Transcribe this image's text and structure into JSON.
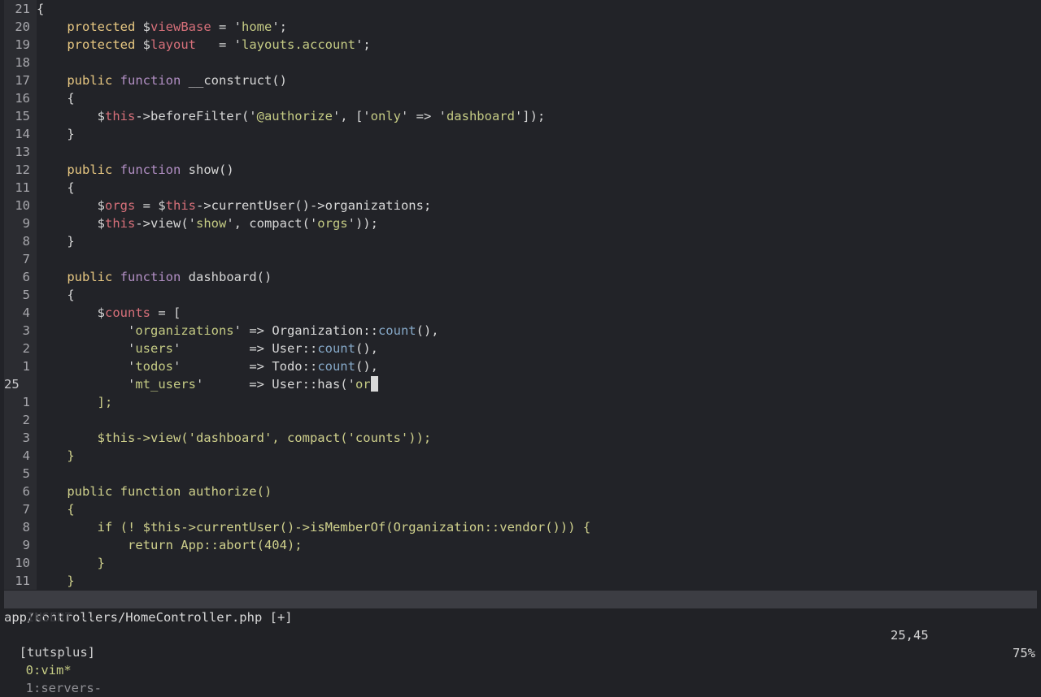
{
  "editor": {
    "lines": [
      {
        "num": "21",
        "tokens": [
          [
            "pl",
            "{"
          ]
        ]
      },
      {
        "num": "20",
        "tokens": [
          [
            "pl",
            "    "
          ],
          [
            "kw",
            "protected"
          ],
          [
            "pl",
            " $"
          ],
          [
            "var",
            "viewBase"
          ],
          [
            "pl",
            " = '"
          ],
          [
            "str",
            "home"
          ],
          [
            "pl",
            "';"
          ]
        ]
      },
      {
        "num": "19",
        "tokens": [
          [
            "pl",
            "    "
          ],
          [
            "kw",
            "protected"
          ],
          [
            "pl",
            " $"
          ],
          [
            "var",
            "layout"
          ],
          [
            "pl",
            "   = '"
          ],
          [
            "str",
            "layouts.account"
          ],
          [
            "pl",
            "';"
          ]
        ]
      },
      {
        "num": "18",
        "tokens": []
      },
      {
        "num": "17",
        "tokens": [
          [
            "pl",
            "    "
          ],
          [
            "kw",
            "public"
          ],
          [
            "pl",
            " "
          ],
          [
            "fn",
            "function"
          ],
          [
            "pl",
            " __construct()"
          ]
        ]
      },
      {
        "num": "16",
        "tokens": [
          [
            "pl",
            "    {"
          ]
        ]
      },
      {
        "num": "15",
        "tokens": [
          [
            "pl",
            "        $"
          ],
          [
            "var",
            "this"
          ],
          [
            "pl",
            "->beforeFilter('"
          ],
          [
            "str",
            "@authorize"
          ],
          [
            "pl",
            "', ['"
          ],
          [
            "str",
            "only"
          ],
          [
            "pl",
            "' => '"
          ],
          [
            "str",
            "dashboard"
          ],
          [
            "pl",
            "']);"
          ]
        ]
      },
      {
        "num": "14",
        "tokens": [
          [
            "pl",
            "    }"
          ]
        ]
      },
      {
        "num": "13",
        "tokens": []
      },
      {
        "num": "12",
        "tokens": [
          [
            "pl",
            "    "
          ],
          [
            "kw",
            "public"
          ],
          [
            "pl",
            " "
          ],
          [
            "fn",
            "function"
          ],
          [
            "pl",
            " show()"
          ]
        ]
      },
      {
        "num": "11",
        "tokens": [
          [
            "pl",
            "    {"
          ]
        ]
      },
      {
        "num": "10",
        "tokens": [
          [
            "pl",
            "        $"
          ],
          [
            "var",
            "orgs"
          ],
          [
            "pl",
            " = $"
          ],
          [
            "var",
            "this"
          ],
          [
            "pl",
            "->currentUser()->organizations;"
          ]
        ]
      },
      {
        "num": "9",
        "tokens": [
          [
            "pl",
            "        $"
          ],
          [
            "var",
            "this"
          ],
          [
            "pl",
            "->view('"
          ],
          [
            "str",
            "show"
          ],
          [
            "pl",
            "', compact('"
          ],
          [
            "str",
            "orgs"
          ],
          [
            "pl",
            "'));"
          ]
        ]
      },
      {
        "num": "8",
        "tokens": [
          [
            "pl",
            "    }"
          ]
        ]
      },
      {
        "num": "7",
        "tokens": []
      },
      {
        "num": "6",
        "tokens": [
          [
            "pl",
            "    "
          ],
          [
            "kw",
            "public"
          ],
          [
            "pl",
            " "
          ],
          [
            "fn",
            "function"
          ],
          [
            "pl",
            " dashboard()"
          ]
        ]
      },
      {
        "num": "5",
        "tokens": [
          [
            "pl",
            "    {"
          ]
        ]
      },
      {
        "num": "4",
        "tokens": [
          [
            "pl",
            "        $"
          ],
          [
            "var",
            "counts"
          ],
          [
            "pl",
            " = ["
          ]
        ]
      },
      {
        "num": "3",
        "tokens": [
          [
            "pl",
            "            '"
          ],
          [
            "str",
            "organizations"
          ],
          [
            "pl",
            "' => Organization::"
          ],
          [
            "cnt",
            "count"
          ],
          [
            "pl",
            "(),"
          ]
        ]
      },
      {
        "num": "2",
        "tokens": [
          [
            "pl",
            "            '"
          ],
          [
            "str",
            "users"
          ],
          [
            "pl",
            "'         => User::"
          ],
          [
            "cnt",
            "count"
          ],
          [
            "pl",
            "(),"
          ]
        ]
      },
      {
        "num": "1",
        "tokens": [
          [
            "pl",
            "            '"
          ],
          [
            "str",
            "todos"
          ],
          [
            "pl",
            "'         => Todo::"
          ],
          [
            "cnt",
            "count"
          ],
          [
            "pl",
            "(),"
          ]
        ]
      },
      {
        "num": "25",
        "current": true,
        "tokens": [
          [
            "pl",
            "            '"
          ],
          [
            "str",
            "mt_users"
          ],
          [
            "pl",
            "'      => User::has('"
          ],
          [
            "str",
            "or"
          ]
        ],
        "cursor": true
      },
      {
        "num": "1",
        "tokens": [
          [
            "dim",
            "        ];"
          ]
        ]
      },
      {
        "num": "2",
        "tokens": []
      },
      {
        "num": "3",
        "tokens": [
          [
            "dim",
            "        $this->view('dashboard', compact('counts'));"
          ]
        ]
      },
      {
        "num": "4",
        "tokens": [
          [
            "dim",
            "    }"
          ]
        ]
      },
      {
        "num": "5",
        "tokens": []
      },
      {
        "num": "6",
        "tokens": [
          [
            "dim",
            "    public function authorize()"
          ]
        ]
      },
      {
        "num": "7",
        "tokens": [
          [
            "dim",
            "    {"
          ]
        ]
      },
      {
        "num": "8",
        "tokens": [
          [
            "dim",
            "        if (! $this->currentUser()->isMemberOf(Organization::vendor())) {"
          ]
        ]
      },
      {
        "num": "9",
        "tokens": [
          [
            "dim",
            "            return App::abort(404);"
          ]
        ]
      },
      {
        "num": "10",
        "tokens": [
          [
            "dim",
            "        }"
          ]
        ]
      },
      {
        "num": "11",
        "tokens": [
          [
            "dim",
            "    }"
          ]
        ]
      }
    ]
  },
  "statusline": {
    "file": "app/controllers/HomeController.php [+]",
    "position": "25,45",
    "percent": "75%"
  },
  "mode": "-- INSERT --",
  "tmux": {
    "session": "[tutsplus]",
    "windows": [
      {
        "label": "0:vim*",
        "active": true
      },
      {
        "label": "1:servers-",
        "active": false
      }
    ]
  },
  "colors": {
    "background": "#222328",
    "keyword": "#e8c882",
    "function_keyword": "#b28fc4",
    "variable": "#d7707a",
    "string": "#c5cb84",
    "method": "#86a9c9",
    "statusline_bg": "#3c3d43"
  }
}
